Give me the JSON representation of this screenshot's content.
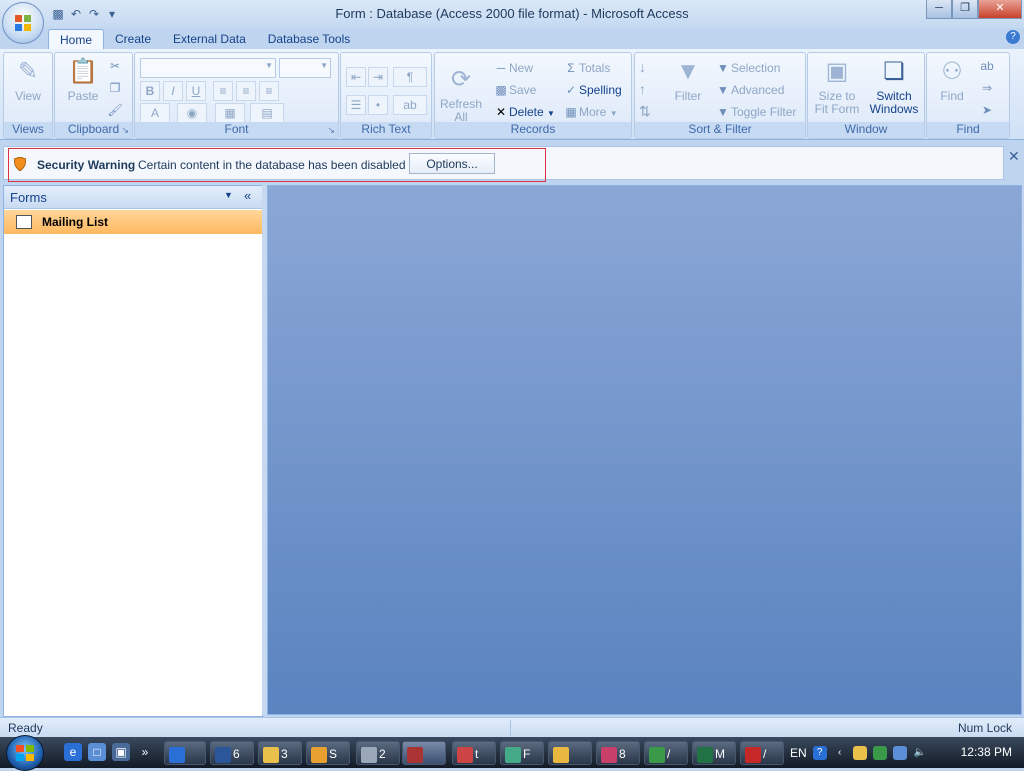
{
  "window": {
    "title": "Form : Database (Access 2000 file format)  -  Microsoft Access"
  },
  "qat": {
    "items": [
      "save-icon",
      "undo-icon",
      "redo-icon",
      "customize-icon"
    ]
  },
  "tabs": [
    "Home",
    "Create",
    "External Data",
    "Database Tools"
  ],
  "ribbon": {
    "views": {
      "label": "Views",
      "view": "View"
    },
    "clipboard": {
      "label": "Clipboard",
      "paste": "Paste"
    },
    "font": {
      "label": "Font",
      "bold": "B",
      "italic": "I",
      "underline": "U",
      "font_color": "A"
    },
    "richtext": {
      "label": "Rich Text"
    },
    "records": {
      "label": "Records",
      "refresh": "Refresh",
      "refresh_sub": "All",
      "new": "New",
      "save": "Save",
      "delete": "Delete",
      "totals": "Totals",
      "spelling": "Spelling",
      "more": "More"
    },
    "sort": {
      "label": "Sort & Filter",
      "filter": "Filter",
      "selection": "Selection",
      "advanced": "Advanced",
      "toggle": "Toggle Filter"
    },
    "window": {
      "label": "Window",
      "size": "Size to",
      "size2": "Fit Form",
      "switch": "Switch",
      "switch2": "Windows"
    },
    "find": {
      "label": "Find",
      "find": "Find"
    }
  },
  "security": {
    "title": "Security Warning",
    "text": "Certain content in the database has been disabled",
    "options": "Options..."
  },
  "nav": {
    "title": "Forms",
    "collapse": "«",
    "items": [
      {
        "label": "Mailing List"
      }
    ]
  },
  "status": {
    "left": "Ready",
    "right": "Num Lock"
  },
  "taskbar": {
    "buttons": [
      {
        "label": "6"
      },
      {
        "label": "3"
      },
      {
        "label": "S"
      },
      {
        "label": "2"
      },
      {
        "label": ""
      },
      {
        "label": "t"
      },
      {
        "label": "F"
      },
      {
        "label": ""
      },
      {
        "label": "8"
      },
      {
        "label": "/"
      },
      {
        "label": "M"
      },
      {
        "label": "/"
      }
    ],
    "lang": "EN",
    "clock": "12:38 PM"
  },
  "colors": {
    "accent": "#15428b",
    "selected": "#ffc77a",
    "warning_border": "#d9333f"
  }
}
